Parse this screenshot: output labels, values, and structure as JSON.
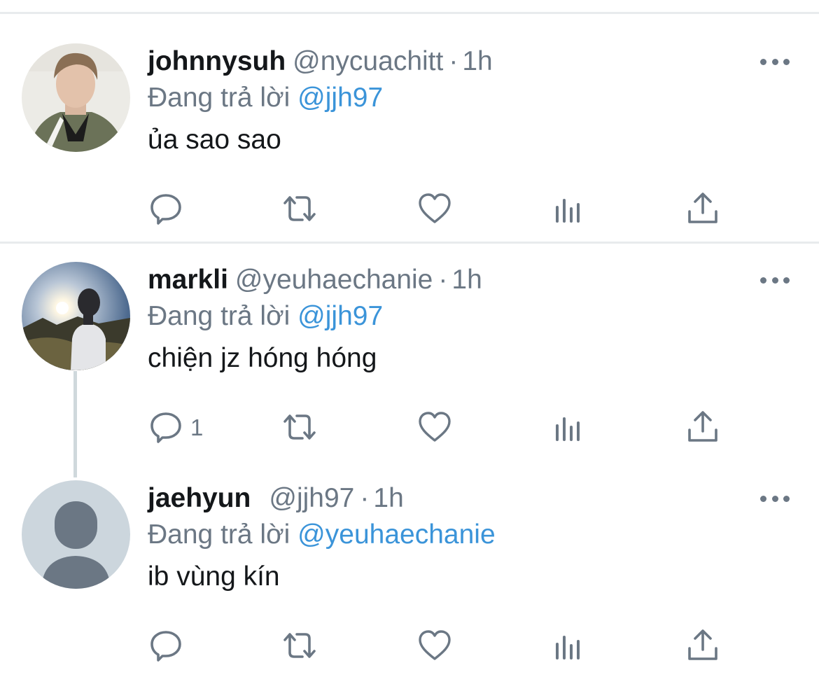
{
  "reply_prefix": "Đang trả lời",
  "tweets": [
    {
      "name": "johnnysuh",
      "handle": "@nycuachitt",
      "separator": "·",
      "time": "1h",
      "reply_to": "@jjh97",
      "text": "ủa sao sao",
      "reply_count": "",
      "avatar": "photo-avatar-man"
    },
    {
      "name": "markli",
      "handle": "@yeuhaechanie",
      "separator": "·",
      "time": "1h",
      "reply_to": "@jjh97",
      "text": "chiện jz hóng hóng",
      "reply_count": "1",
      "avatar": "photo-avatar-sunset"
    },
    {
      "name": "jaehyun",
      "handle": "@jjh97",
      "separator": "·",
      "time": "1h",
      "reply_to": "@yeuhaechanie",
      "text": "ib vùng kín",
      "reply_count": "",
      "avatar": "default-avatar"
    }
  ],
  "colors": {
    "icon_gray": "#6b7784",
    "mention_blue": "#3b94d9",
    "text_dark": "#14171a"
  }
}
